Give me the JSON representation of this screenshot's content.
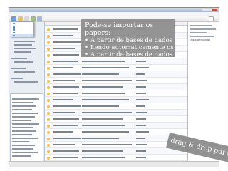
{
  "callout": {
    "title": "Pode-se importar os papers:",
    "items": [
      "A partir de bases de dados bibliográficas",
      "Lendo automaticamente os pdf's",
      "A partir de bases de dados"
    ],
    "bullet": "•"
  },
  "drag_note": "drag & drop pdf files",
  "colors": {
    "callout_bg": "#8f8f8f",
    "callout_text": "#ffffff",
    "selection": "#cfe0f5",
    "close_button": "#c64b3b"
  }
}
